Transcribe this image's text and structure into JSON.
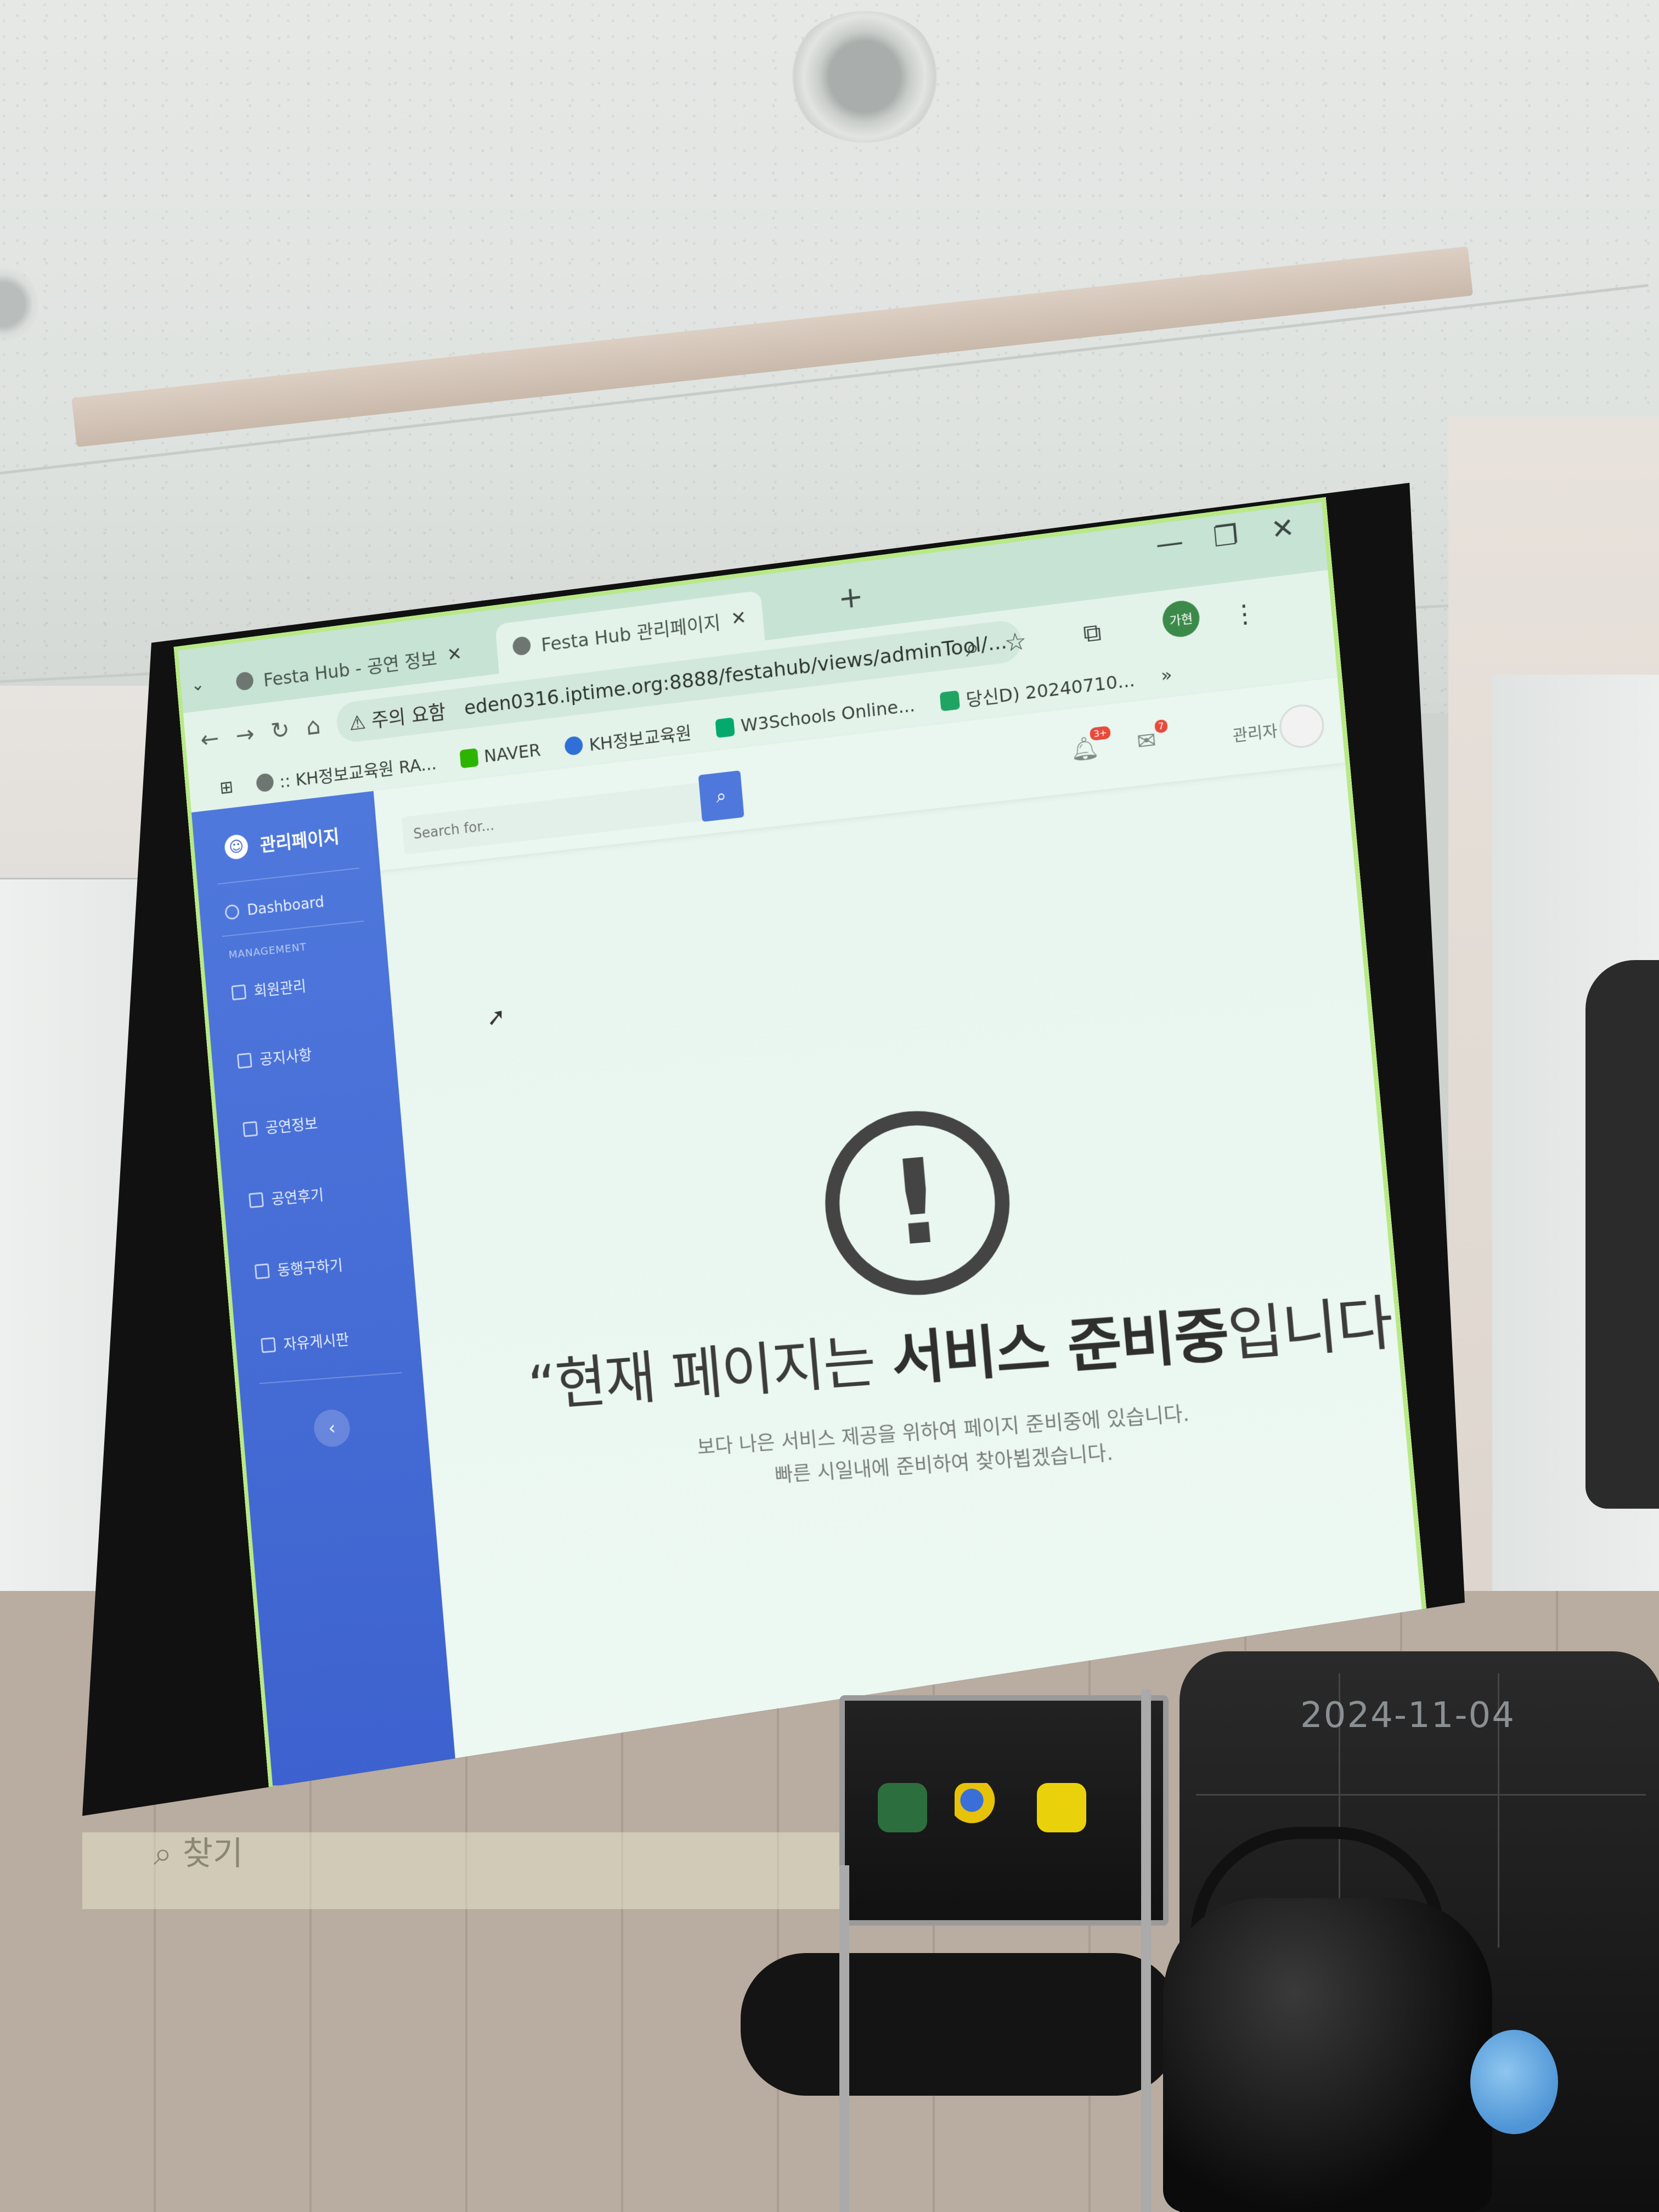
{
  "browser": {
    "tabs": [
      {
        "label": "Festa Hub - 공연 정보"
      },
      {
        "label": "Festa Hub 관리페이지"
      }
    ],
    "window_controls": {
      "minimize": "—",
      "restore": "❐",
      "close": "✕"
    },
    "omnibox": {
      "security_warning": "⚠ 주의 요함",
      "url": "eden0316.iptime.org:8888/festahub/views/adminTool/..."
    },
    "profile_label": "가현",
    "bookmarks": [
      {
        "label": ":: KH정보교육원 RA...",
        "color": "#6d7671"
      },
      {
        "label": "NAVER",
        "color": "#2db400"
      },
      {
        "label": "KH정보교육원",
        "color": "#2f6fd6"
      },
      {
        "label": "W3Schools Online...",
        "color": "#04aa6d"
      },
      {
        "label": "당신D) 20240710...",
        "color": "#1fa463"
      }
    ]
  },
  "admin": {
    "brand": "관리페이지",
    "dashboard": "Dashboard",
    "section_heading": "MANAGEMENT",
    "menu": [
      "회원관리",
      "공지사항",
      "공연정보",
      "공연후기",
      "동행구하기",
      "자유게시판"
    ],
    "search_placeholder": "Search for...",
    "alerts_badge": "3+",
    "messages_badge": "7",
    "user_name": "관리자",
    "accent_color": "#4e73df"
  },
  "notice": {
    "headline_regular_1": "현재 페이지는 ",
    "headline_bold": "서비스 준비중",
    "headline_regular_2": "입니다.",
    "quote_open": "“",
    "quote_close": "”",
    "line1": "보다 나은 서비스 제공을 위하여 페이지 준비중에 있습니다.",
    "line2": "빠른 시일내에 준비하여 찾아뵙겠습니다."
  },
  "taskbar": {
    "search_label": "찾기"
  },
  "photo_overlay": {
    "date": "2024-11-04"
  }
}
